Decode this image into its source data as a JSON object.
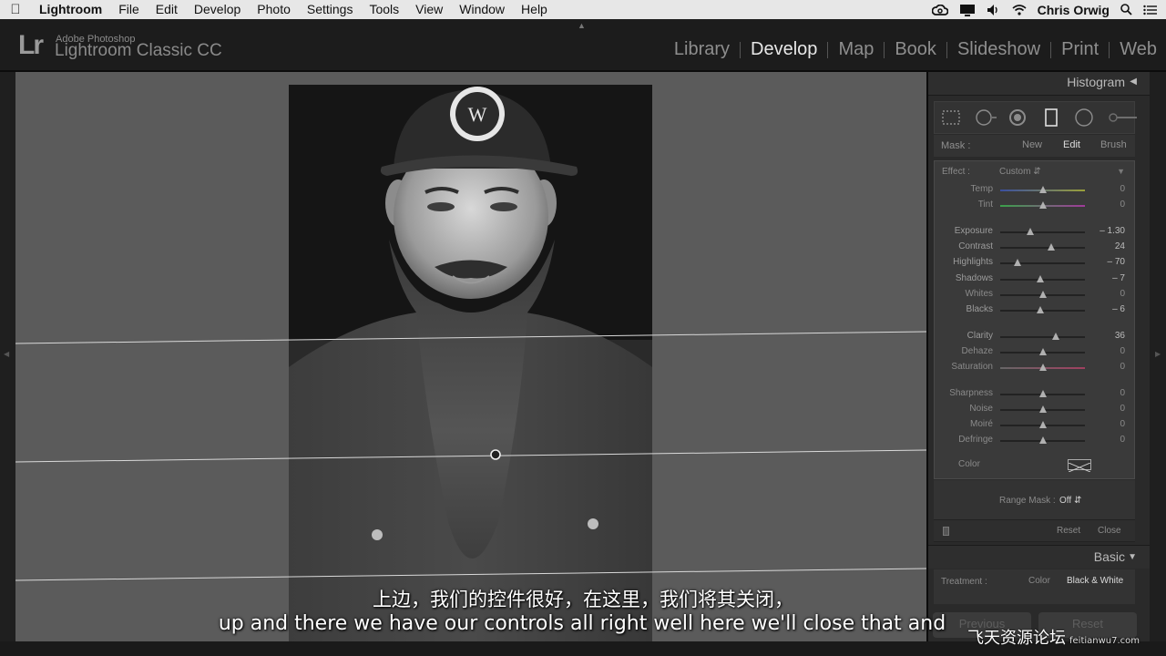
{
  "menubar": {
    "items": [
      "Lightroom",
      "File",
      "Edit",
      "Develop",
      "Photo",
      "Settings",
      "Tools",
      "View",
      "Window",
      "Help"
    ],
    "user": "Chris Orwig"
  },
  "identity": {
    "logo": "Lr",
    "vendor": "Adobe Photoshop",
    "app_name": "Lightroom Classic CC"
  },
  "modules": [
    "Library",
    "Develop",
    "Map",
    "Book",
    "Slideshow",
    "Print",
    "Web"
  ],
  "active_module": "Develop",
  "panel": {
    "histogram_title": "Histogram",
    "mask": {
      "label": "Mask :",
      "new": "New",
      "edit": "Edit",
      "brush": "Brush"
    },
    "effect": {
      "label": "Effect :",
      "value": "Custom"
    },
    "sliders": [
      {
        "label": "Temp",
        "value": "0",
        "pos": 0.5,
        "track": "temp"
      },
      {
        "label": "Tint",
        "value": "0",
        "pos": 0.5,
        "track": "tint"
      },
      {
        "label": "Exposure",
        "value": "– 1.30",
        "pos": 0.36,
        "set": true
      },
      {
        "label": "Contrast",
        "value": "24",
        "pos": 0.6,
        "set": true
      },
      {
        "label": "Highlights",
        "value": "– 70",
        "pos": 0.2,
        "set": true
      },
      {
        "label": "Shadows",
        "value": "– 7",
        "pos": 0.47,
        "set": true
      },
      {
        "label": "Whites",
        "value": "0",
        "pos": 0.5
      },
      {
        "label": "Blacks",
        "value": "– 6",
        "pos": 0.47,
        "set": true
      },
      {
        "label": "Clarity",
        "value": "36",
        "pos": 0.66,
        "set": true
      },
      {
        "label": "Dehaze",
        "value": "0",
        "pos": 0.5
      },
      {
        "label": "Saturation",
        "value": "0",
        "pos": 0.5,
        "track": "sat"
      },
      {
        "label": "Sharpness",
        "value": "0",
        "pos": 0.5
      },
      {
        "label": "Noise",
        "value": "0",
        "pos": 0.5
      },
      {
        "label": "Moiré",
        "value": "0",
        "pos": 0.5
      },
      {
        "label": "Defringe",
        "value": "0",
        "pos": 0.5
      }
    ],
    "color_label": "Color",
    "range_mask": {
      "label": "Range Mask :",
      "value": "Off"
    },
    "footer": {
      "reset": "Reset",
      "close": "Close"
    },
    "basic_title": "Basic",
    "treatment": {
      "label": "Treatment :",
      "color": "Color",
      "bw": "Black & White"
    },
    "previous_button": "Previous",
    "reset_button": "Reset"
  },
  "subtitles": {
    "cn": "上边，我们的控件很好，在这里，我们将其关闭，",
    "en": "up and there we have our controls all right well here we'll close that and"
  },
  "watermark": {
    "text": "飞天资源论坛",
    "url": "feitianwu7.com"
  }
}
